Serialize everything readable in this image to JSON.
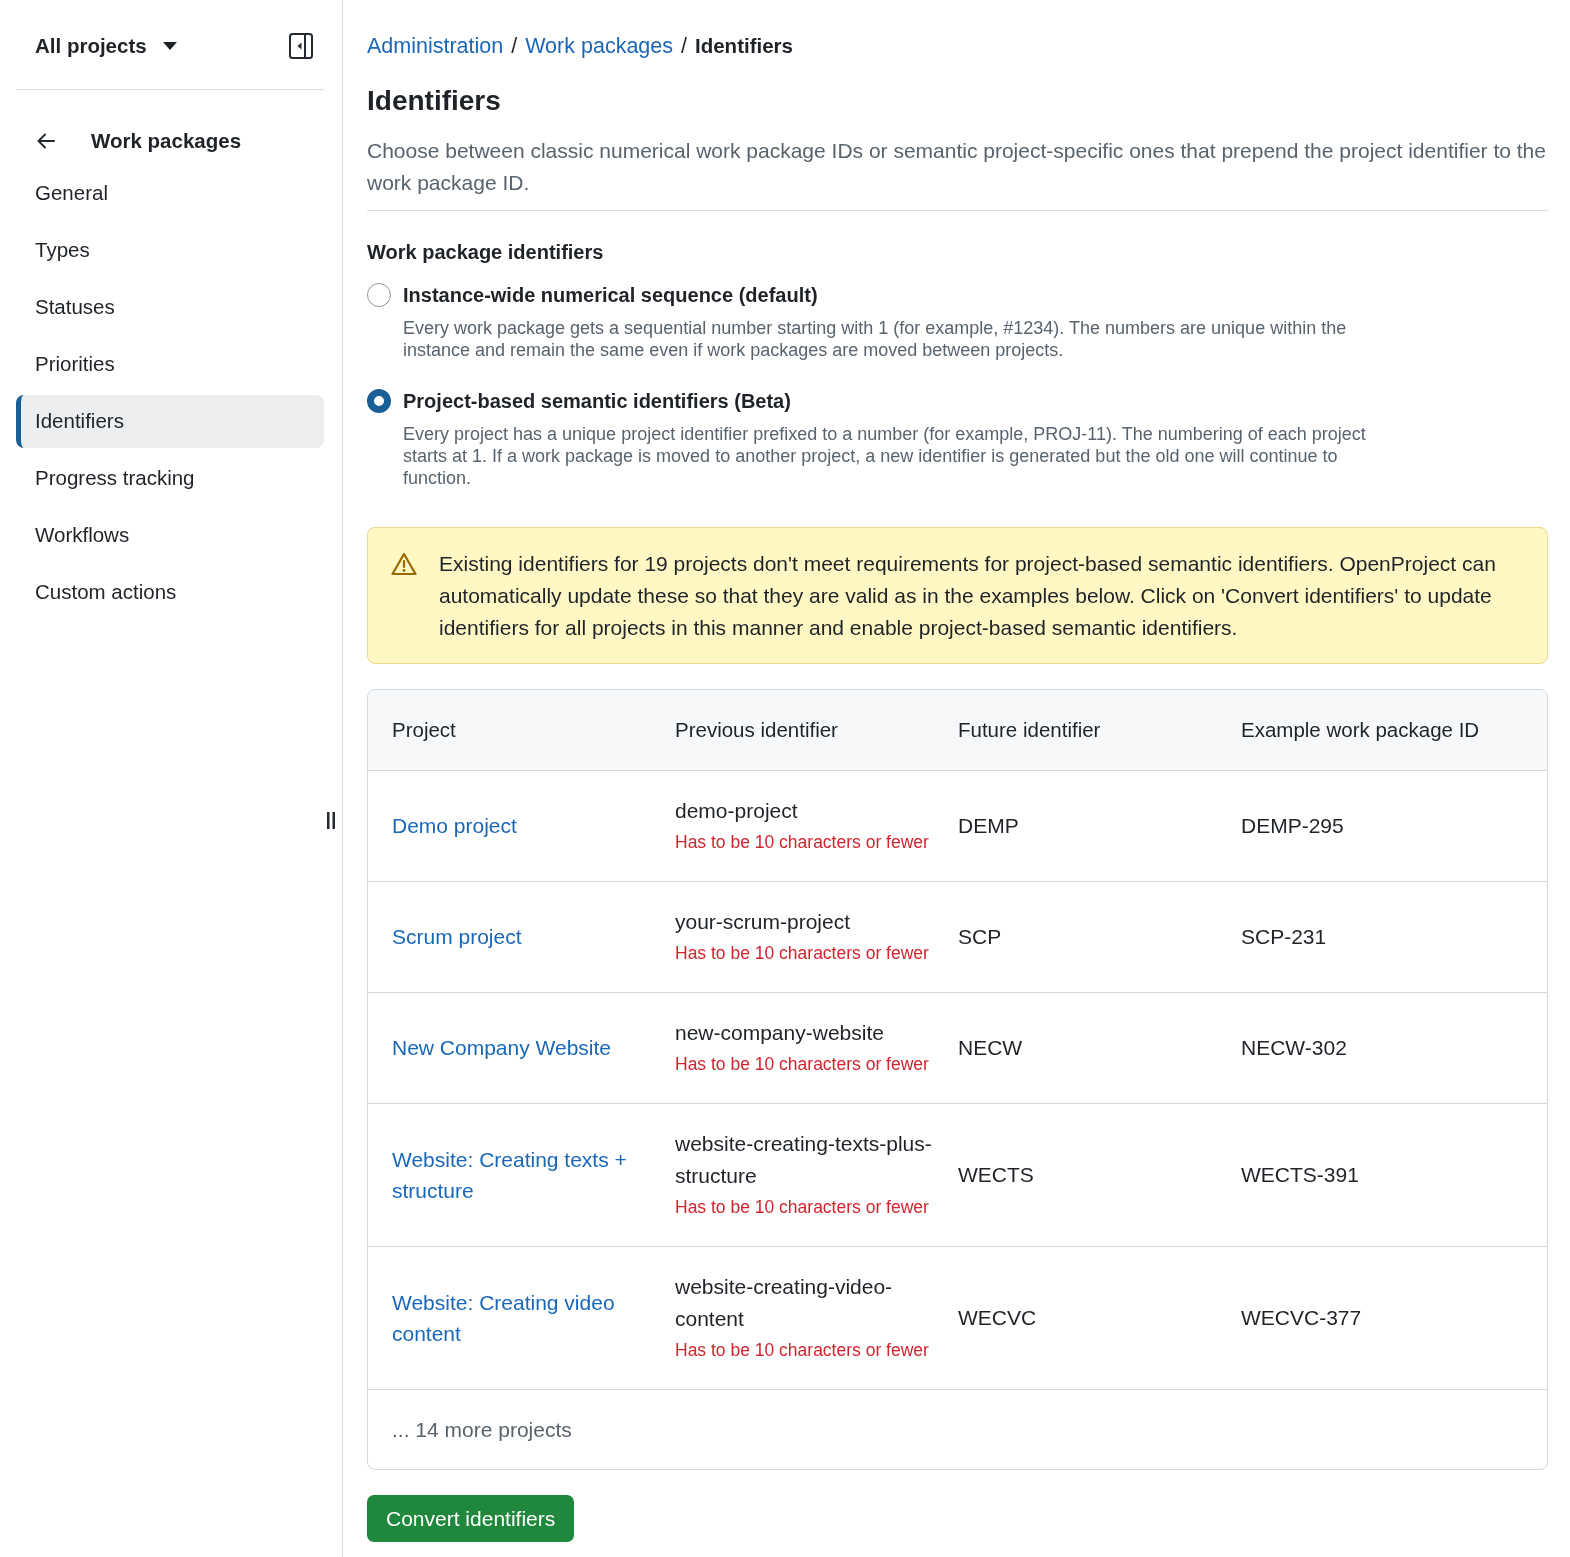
{
  "sidebar": {
    "project_selector": "All projects",
    "heading": "Work packages",
    "items": [
      {
        "label": "General",
        "selected": false
      },
      {
        "label": "Types",
        "selected": false
      },
      {
        "label": "Statuses",
        "selected": false
      },
      {
        "label": "Priorities",
        "selected": false
      },
      {
        "label": "Identifiers",
        "selected": true
      },
      {
        "label": "Progress tracking",
        "selected": false
      },
      {
        "label": "Workflows",
        "selected": false
      },
      {
        "label": "Custom actions",
        "selected": false
      }
    ]
  },
  "breadcrumb": [
    {
      "kind": "link",
      "label": "Administration"
    },
    {
      "kind": "separator",
      "label": "/"
    },
    {
      "kind": "link",
      "label": "Work packages"
    },
    {
      "kind": "separator",
      "label": "/"
    },
    {
      "kind": "current",
      "label": "Identifiers"
    }
  ],
  "page": {
    "title": "Identifiers",
    "description": "Choose between classic numerical work package IDs or semantic project-specific ones that prepend the project identifier to the work package ID."
  },
  "section": {
    "title": "Work package identifiers",
    "options": [
      {
        "label": "Instance-wide numerical sequence (default)",
        "description": "Every work package gets a sequential number starting with 1 (for example, #1234). The numbers are unique within the instance and remain the same even if work packages are moved between projects.",
        "selected": false
      },
      {
        "label": "Project-based semantic identifiers (Beta)",
        "description": "Every project has a unique project identifier prefixed to a number (for example, PROJ-11). The numbering of each project starts at 1. If a work package is moved to another project, a new identifier is generated but the old one will continue to function.",
        "selected": true
      }
    ]
  },
  "warning": {
    "text": "Existing identifiers for 19 projects don't meet requirements for project-based semantic identifiers. OpenProject can automatically update these so that they are valid as in the examples below. Click on 'Convert identifiers' to update identifiers for all projects in this manner and enable project-based semantic identifiers."
  },
  "table": {
    "columns": [
      "Project",
      "Previous identifier",
      "Future identifier",
      "Example work package ID"
    ],
    "rows": [
      {
        "project": "Demo project",
        "previous_identifier": "demo-project",
        "error": "Has to be 10 characters or fewer",
        "future_identifier": "DEMP",
        "example_id": "DEMP-295"
      },
      {
        "project": "Scrum project",
        "previous_identifier": "your-scrum-project",
        "error": "Has to be 10 characters or fewer",
        "future_identifier": "SCP",
        "example_id": "SCP-231"
      },
      {
        "project": "New Company Website",
        "previous_identifier": "new-company-website",
        "error": "Has to be 10 characters or fewer",
        "future_identifier": "NECW",
        "example_id": "NECW-302"
      },
      {
        "project": "Website: Creating texts + structure",
        "previous_identifier": "website-creating-texts-plus-structure",
        "error": "Has to be 10 characters or fewer",
        "future_identifier": "WECTS",
        "example_id": "WECTS-391"
      },
      {
        "project": "Website: Creating video content",
        "previous_identifier": "website-creating-video-content",
        "error": "Has to be 10 characters or fewer",
        "future_identifier": "WECVC",
        "example_id": "WECVC-377"
      }
    ],
    "footer": "... 14 more projects"
  },
  "primary_button": "Convert identifiers"
}
